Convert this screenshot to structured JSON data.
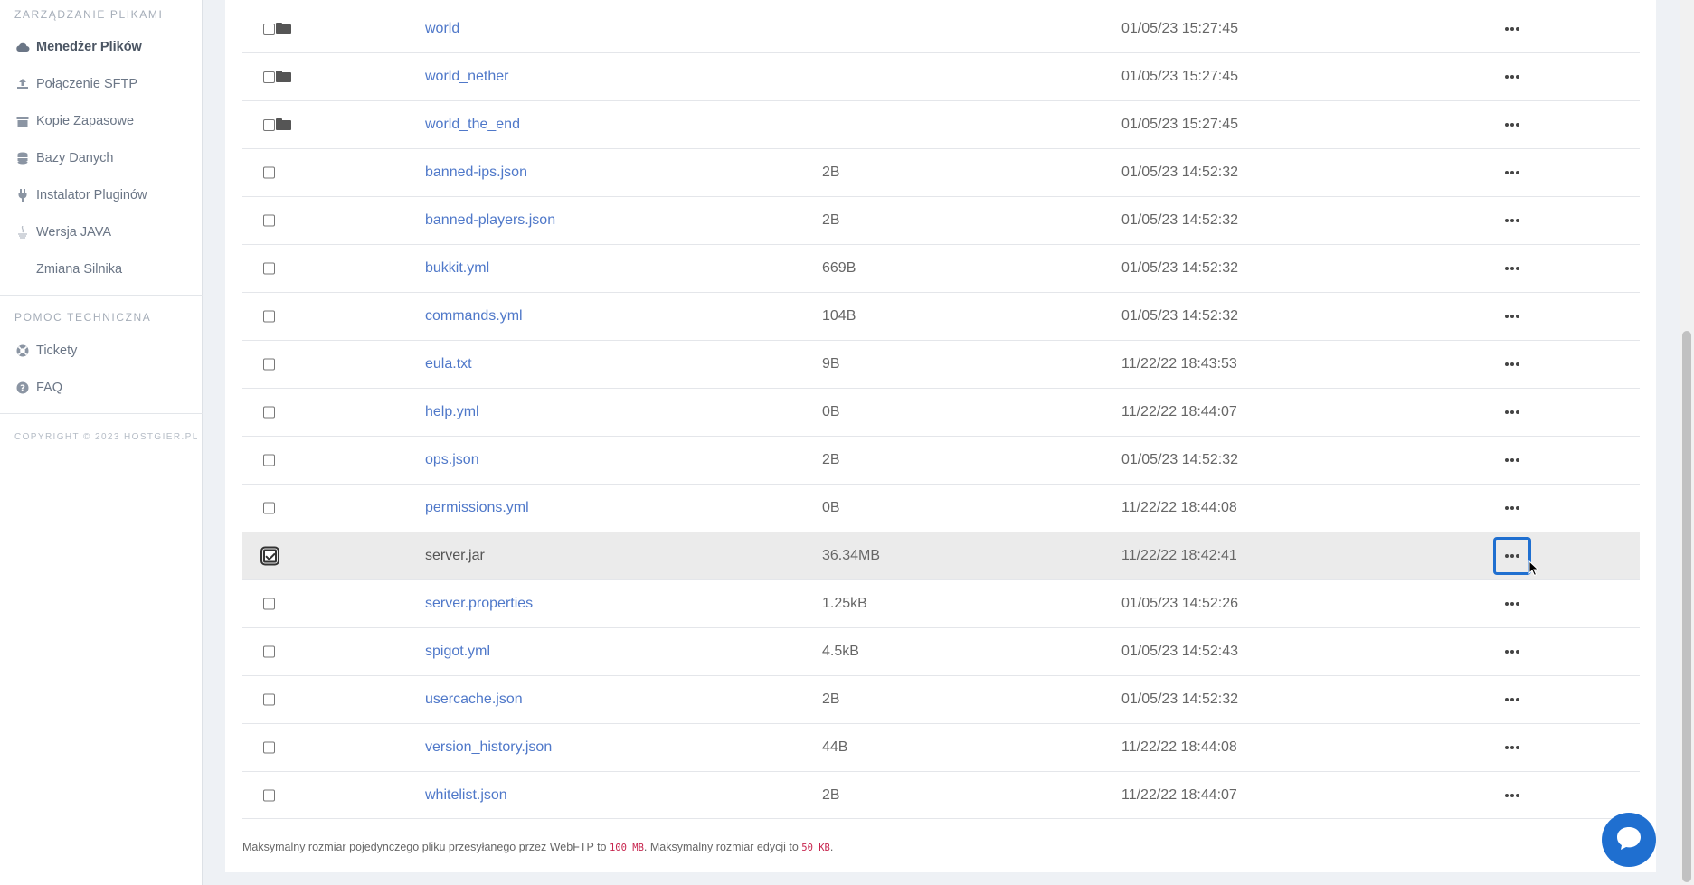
{
  "sidebar": {
    "section_files": "ZARZĄDZANIE PLIKAMI",
    "items": [
      {
        "label": "Menedżer Plików",
        "icon": "cloud-icon",
        "active": true
      },
      {
        "label": "Połączenie SFTP",
        "icon": "upload-icon"
      },
      {
        "label": "Kopie Zapasowe",
        "icon": "archive-icon"
      },
      {
        "label": "Bazy Danych",
        "icon": "database-icon"
      },
      {
        "label": "Instalator Pluginów",
        "icon": "plug-icon"
      },
      {
        "label": "Wersja JAVA",
        "icon": "java-icon"
      },
      {
        "label": "Zmiana Silnika",
        "icon": ""
      }
    ],
    "section_support": "POMOC TECHNICZNA",
    "support_items": [
      {
        "label": "Tickety",
        "icon": "lifebuoy-icon"
      },
      {
        "label": "FAQ",
        "icon": "question-circle-icon"
      }
    ],
    "copyright": "COPYRIGHT © 2023 HOSTGIER.PL"
  },
  "files": [
    {
      "name": "world",
      "size": "",
      "date": "01/05/23 15:27:45",
      "folder": true
    },
    {
      "name": "world_nether",
      "size": "",
      "date": "01/05/23 15:27:45",
      "folder": true
    },
    {
      "name": "world_the_end",
      "size": "",
      "date": "01/05/23 15:27:45",
      "folder": true
    },
    {
      "name": "banned-ips.json",
      "size": "2B",
      "date": "01/05/23 14:52:32"
    },
    {
      "name": "banned-players.json",
      "size": "2B",
      "date": "01/05/23 14:52:32"
    },
    {
      "name": "bukkit.yml",
      "size": "669B",
      "date": "01/05/23 14:52:32"
    },
    {
      "name": "commands.yml",
      "size": "104B",
      "date": "01/05/23 14:52:32"
    },
    {
      "name": "eula.txt",
      "size": "9B",
      "date": "11/22/22 18:43:53"
    },
    {
      "name": "help.yml",
      "size": "0B",
      "date": "11/22/22 18:44:07"
    },
    {
      "name": "ops.json",
      "size": "2B",
      "date": "01/05/23 14:52:32"
    },
    {
      "name": "permissions.yml",
      "size": "0B",
      "date": "11/22/22 18:44:08"
    },
    {
      "name": "server.jar",
      "size": "36.34MB",
      "date": "11/22/22 18:42:41",
      "selected": true
    },
    {
      "name": "server.properties",
      "size": "1.25kB",
      "date": "01/05/23 14:52:26"
    },
    {
      "name": "spigot.yml",
      "size": "4.5kB",
      "date": "01/05/23 14:52:43"
    },
    {
      "name": "usercache.json",
      "size": "2B",
      "date": "01/05/23 14:52:32"
    },
    {
      "name": "version_history.json",
      "size": "44B",
      "date": "11/22/22 18:44:08"
    },
    {
      "name": "whitelist.json",
      "size": "2B",
      "date": "11/22/22 18:44:07"
    }
  ],
  "footnote": {
    "part1": "Maksymalny rozmiar pojedynczego pliku przesyłanego przez WebFTP to ",
    "limit_upload": "100 MB",
    "part2": ". Maksymalny rozmiar edycji to ",
    "limit_edit": "50 KB",
    "part3": "."
  },
  "colors": {
    "link": "#4f78c9",
    "accent": "#1f6fd0",
    "selected_row": "#ebebeb"
  }
}
